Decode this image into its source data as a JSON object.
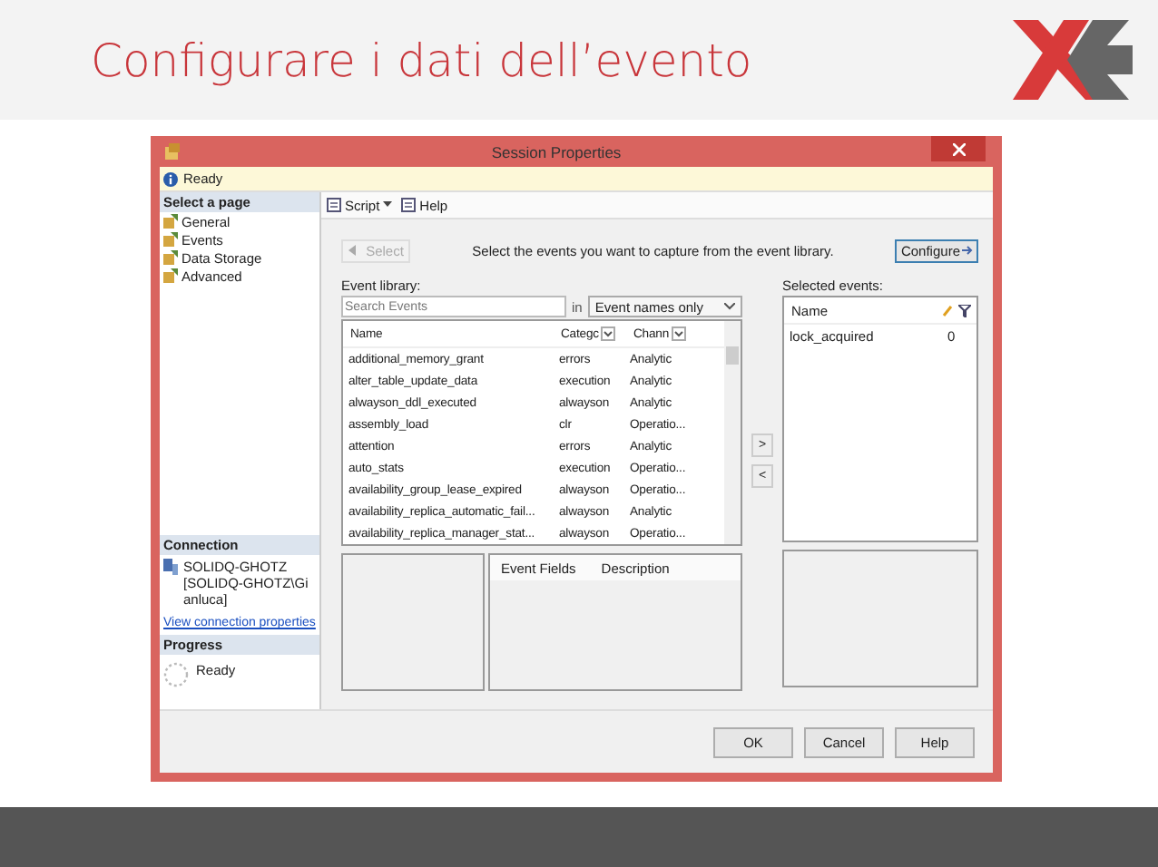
{
  "slide": {
    "title": "Configurare i dati dell’evento"
  },
  "window": {
    "title": "Session Properties"
  },
  "status": "Ready",
  "sidebar": {
    "heading": "Select a page",
    "items": [
      "General",
      "Events",
      "Data Storage",
      "Advanced"
    ]
  },
  "connection": {
    "heading": "Connection",
    "server": "SOLIDQ-GHOTZ",
    "user": "[SOLIDQ-GHOTZ\\Gianluca]",
    "link": "View connection properties"
  },
  "progress": {
    "heading": "Progress",
    "status": "Ready"
  },
  "toolbar": [
    "Script",
    "Help"
  ],
  "events": {
    "select_button": {
      "label": "Select",
      "disabled": true
    },
    "instruction": "Select the events you want to capture from the event library.",
    "configure_button": "Configure",
    "library_label": "Event library:",
    "search": {
      "placeholder": "Search Events"
    },
    "in_label": "in",
    "scope": "Event names only",
    "columns": [
      "Name",
      "Categc",
      "Chann"
    ],
    "rows": [
      [
        "additional_memory_grant",
        "errors",
        "Analytic"
      ],
      [
        "alter_table_update_data",
        "execution",
        "Analytic"
      ],
      [
        "alwayson_ddl_executed",
        "alwayson",
        "Analytic"
      ],
      [
        "assembly_load",
        "clr",
        "Operatio..."
      ],
      [
        "attention",
        "errors",
        "Analytic"
      ],
      [
        "auto_stats",
        "execution",
        "Operatio..."
      ],
      [
        "availability_group_lease_expired",
        "alwayson",
        "Operatio..."
      ],
      [
        "availability_replica_automatic_fail...",
        "alwayson",
        "Analytic"
      ],
      [
        "availability_replica_manager_stat...",
        "alwayson",
        "Operatio..."
      ]
    ],
    "add_button": ">",
    "remove_button": "<",
    "selected_label": "Selected events:",
    "selected_columns": [
      "Name"
    ],
    "selected_rows": [
      [
        "lock_acquired",
        "0"
      ]
    ],
    "detail_columns": [
      "Event Fields",
      "Description"
    ]
  },
  "buttons": [
    "OK",
    "Cancel",
    "Help"
  ]
}
